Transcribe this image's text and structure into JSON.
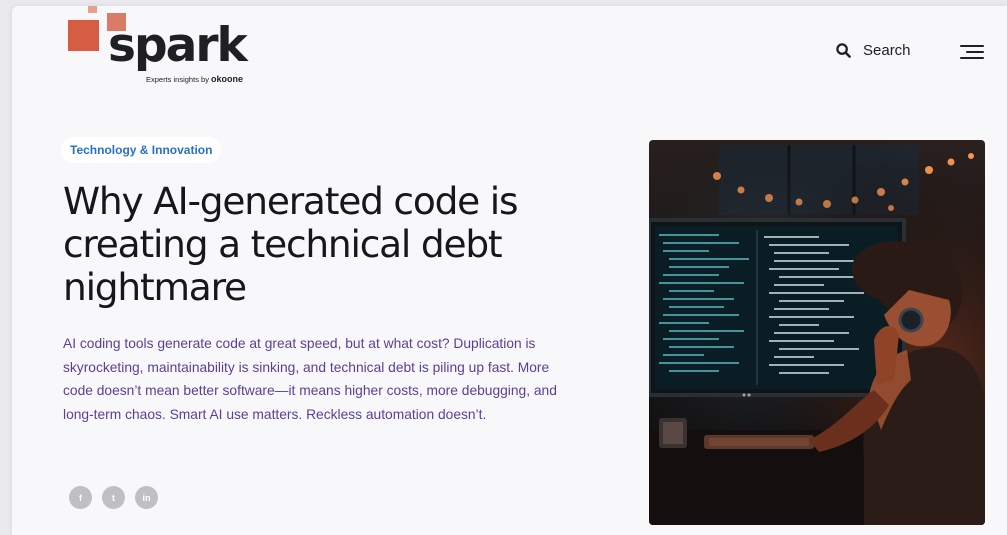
{
  "brand": {
    "name": "spark",
    "tagline_prefix": "Experts insights by",
    "tagline_brand": "okoone",
    "colors": {
      "square_dark": "#d65c44",
      "square_mid": "#d97b66",
      "square_light": "#e6a090"
    }
  },
  "header": {
    "search_label": "Search",
    "search_icon": "search-icon",
    "menu_icon": "hamburger-menu-icon"
  },
  "article": {
    "category": "Technology & Innovation",
    "title": "Why AI-generated code is creating a technical debt nightmare",
    "excerpt": "AI coding tools generate code at great speed, but at what cost? Duplication is skyrocketing, maintainability is sinking, and technical debt is piling up fast. More code doesn’t mean better software—it means higher costs, more debugging, and long-term chaos. Smart AI use matters. Reckless automation doesn’t.",
    "colors": {
      "category": "#2a6fc9",
      "excerpt": "#5b3f97",
      "title": "#16161b"
    }
  },
  "share": [
    {
      "name": "facebook",
      "glyph": "f"
    },
    {
      "name": "twitter",
      "glyph": "t"
    },
    {
      "name": "linkedin",
      "glyph": "in"
    }
  ]
}
